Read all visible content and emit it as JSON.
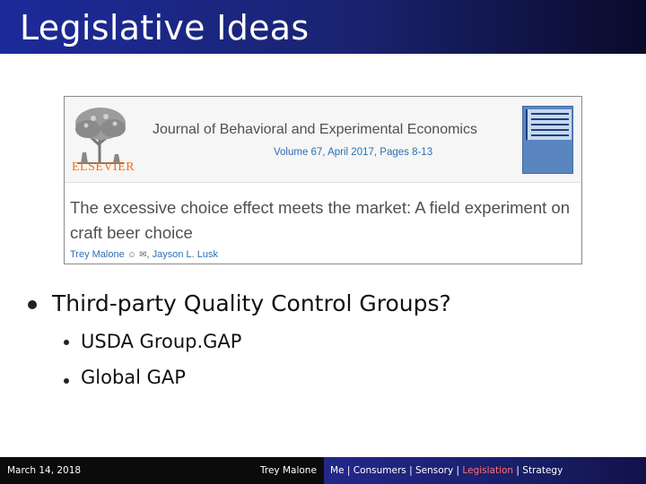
{
  "slide": {
    "title": "Legislative Ideas"
  },
  "article": {
    "publisher": "ELSEVIER",
    "journal": "Journal of Behavioral and Experimental Economics",
    "volume": "Volume 67, April 2017, Pages 8-13",
    "title": "The excessive choice effect meets the market: A field experiment on craft beer choice",
    "author1": "Trey Malone",
    "author2": "Jayson L. Lusk",
    "colors": {
      "publisher": "#e9711c",
      "link": "#2e6fb3",
      "text": "#505050"
    }
  },
  "bullets": {
    "main": "Third-party Quality Control Groups?",
    "sub": [
      "USDA Group.GAP",
      "Global GAP"
    ]
  },
  "footer": {
    "date": "March 14, 2018",
    "presenter": "Trey Malone",
    "nav": [
      "Me",
      "Consumers",
      "Sensory",
      "Legislation",
      "Strategy"
    ],
    "active_index": 3,
    "active_color": "#ff6f6f"
  }
}
